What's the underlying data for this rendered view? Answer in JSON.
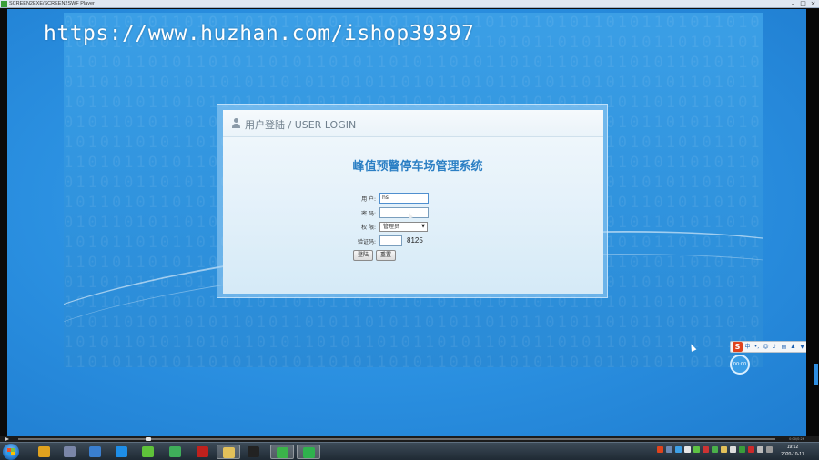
{
  "window": {
    "title": "SCREEN2EXE/SCREEN2SWF Player",
    "minimize": "–",
    "maximize": "□",
    "close": "×"
  },
  "watermark": "https://www.huzhan.com/ishop39397",
  "login": {
    "header": "用户登陆 / USER LOGIN",
    "system_title": "峰值预警停车场管理系统",
    "username_label": "用  户:",
    "username_value": "hsl",
    "password_label": "密  码:",
    "password_value": "",
    "role_label": "权  限:",
    "role_value": "管理员",
    "captcha_label": "验证码:",
    "captcha_input": "",
    "captcha_code": "8125",
    "login_button": "登陆",
    "reset_button": "重置"
  },
  "ime": {
    "logo": "S",
    "mode": "中",
    "icons": [
      "punct-icon",
      "emoji-icon",
      "mic-icon",
      "keyboard-icon",
      "user-icon",
      "shirt-icon",
      "grid-icon"
    ]
  },
  "badge": "00:00",
  "player": {
    "time": "0:00/0:26"
  },
  "taskbar": {
    "apps": [
      {
        "name": "chrome",
        "color": "#e0a21f"
      },
      {
        "name": "media",
        "color": "#7a86a8"
      },
      {
        "name": "network",
        "color": "#3a7fd0"
      },
      {
        "name": "qq-browser",
        "color": "#1e8ee8"
      },
      {
        "name": "melon",
        "color": "#5fc23a"
      },
      {
        "name": "spreadsheet",
        "color": "#3fae5a"
      },
      {
        "name": "flash",
        "color": "#c0211d"
      },
      {
        "name": "folder",
        "color": "#e3c15a"
      },
      {
        "name": "qq",
        "color": "#222222"
      },
      {
        "name": "wechat",
        "color": "#3bb34a"
      },
      {
        "name": "player",
        "color": "#2fb24d"
      }
    ],
    "clock_time": "19:12",
    "clock_date": "2020-10-17"
  },
  "colors": {
    "desktop": "#2a8fe0",
    "title_blue": "#2b7fc4",
    "taskbar": "#1f2a34"
  }
}
